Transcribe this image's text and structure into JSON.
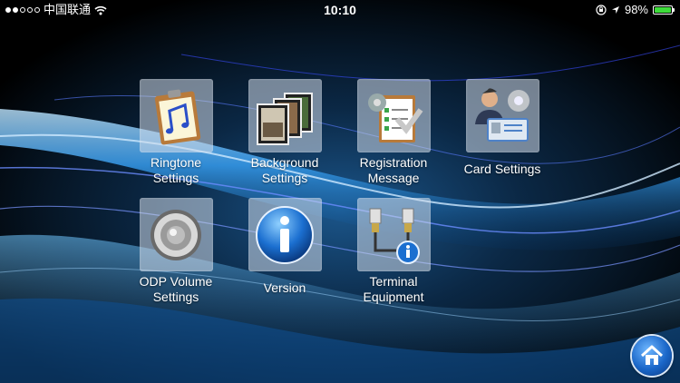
{
  "status_bar": {
    "carrier": "中国联通",
    "time": "10:10",
    "battery": "98%",
    "battery_level": 0.98,
    "icons": [
      "signal-dots-icon",
      "wifi-icon",
      "orientation-lock-icon",
      "location-arrow-icon",
      "battery-icon"
    ]
  },
  "menu": {
    "items": [
      {
        "id": "ringtone",
        "line1": "Ringtone",
        "line2": "Settings",
        "icon": "music-note-clipboard-icon"
      },
      {
        "id": "background",
        "line1": "Background",
        "line2": "Settings",
        "icon": "photo-frames-icon"
      },
      {
        "id": "registration",
        "line1": "Registration",
        "line2": "Message",
        "icon": "checklist-gear-icon"
      },
      {
        "id": "card",
        "line1": "Card Settings",
        "line2": "",
        "icon": "user-card-gear-icon"
      },
      {
        "id": "odp_volume",
        "line1": "ODP Volume",
        "line2": "Settings",
        "icon": "speaker-icon"
      },
      {
        "id": "version",
        "line1": "Version",
        "line2": "",
        "icon": "info-icon"
      },
      {
        "id": "terminal",
        "line1": "Terminal",
        "line2": "Equipment",
        "icon": "network-cable-info-icon"
      }
    ]
  },
  "home_button": {
    "icon": "home-icon"
  },
  "colors": {
    "background": "#000000",
    "wave_blue": "#3aa8ff",
    "battery_green": "#3ddc3a"
  }
}
